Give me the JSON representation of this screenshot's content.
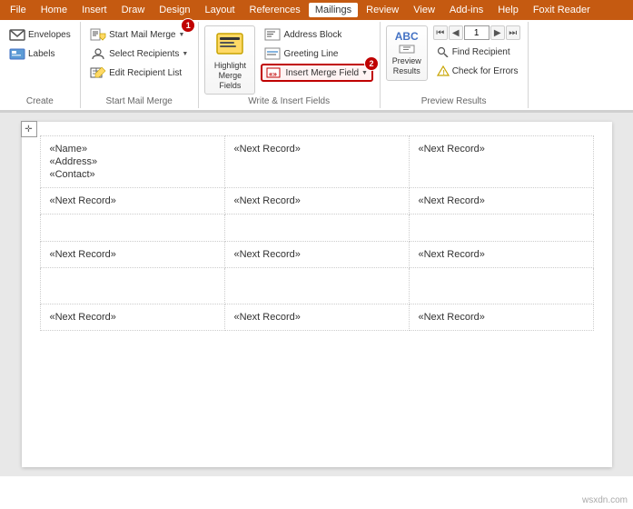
{
  "menu": {
    "items": [
      "File",
      "Home",
      "Insert",
      "Draw",
      "Design",
      "Layout",
      "References",
      "Mailings",
      "Review",
      "View",
      "Add-ins",
      "Help",
      "Foxit Reader"
    ],
    "active": "Mailings"
  },
  "ribbon": {
    "groups": {
      "create": {
        "label": "Create",
        "buttons": [
          "Envelopes",
          "Labels"
        ]
      },
      "start_mail_merge": {
        "label": "Start Mail Merge",
        "buttons": [
          "Start Mail Merge",
          "Select Recipients",
          "Edit Recipient List"
        ]
      },
      "write_insert": {
        "label": "Write & Insert Fields",
        "buttons": [
          "Highlight Merge Fields",
          "Address Block",
          "Greeting Line",
          "Insert Merge Field"
        ]
      },
      "preview_results": {
        "label": "Preview Results",
        "buttons": [
          "Preview Results",
          "Find Recipient",
          "Check for Errors"
        ],
        "page_input": "1"
      }
    }
  },
  "badges": {
    "one": "1",
    "two": "2"
  },
  "document": {
    "cells": [
      [
        "«Name»",
        "«Address»",
        "«Contact»"
      ],
      [
        "«Next Record»",
        "",
        ""
      ],
      [
        "«Next Record»",
        "«Next Record»",
        "«Next Record»"
      ],
      [
        "«Next Record»",
        "«Next Record»",
        "«Next Record»"
      ],
      [
        "«Next Record»",
        "«Next Record»",
        "«Next Record»"
      ]
    ],
    "row1": {
      "col1": [
        "«Name»",
        "«Address»",
        "«Contact»"
      ],
      "col2": [
        "«Next Record»"
      ],
      "col3": [
        "«Next Record»"
      ]
    },
    "row2": {
      "col1": [
        "«Next Record»"
      ],
      "col2": [
        "«Next Record»"
      ],
      "col3": [
        "«Next Record»"
      ]
    },
    "row3": {
      "col1": [
        "«Next Record»"
      ],
      "col2": [
        "«Next Record»"
      ],
      "col3": [
        "«Next Record»"
      ]
    },
    "row4": {
      "col1": [
        "«Next Record»"
      ],
      "col2": [
        "«Next Record»"
      ],
      "col3": [
        "«Next Record»"
      ]
    }
  },
  "watermark": "wsxdn.com"
}
